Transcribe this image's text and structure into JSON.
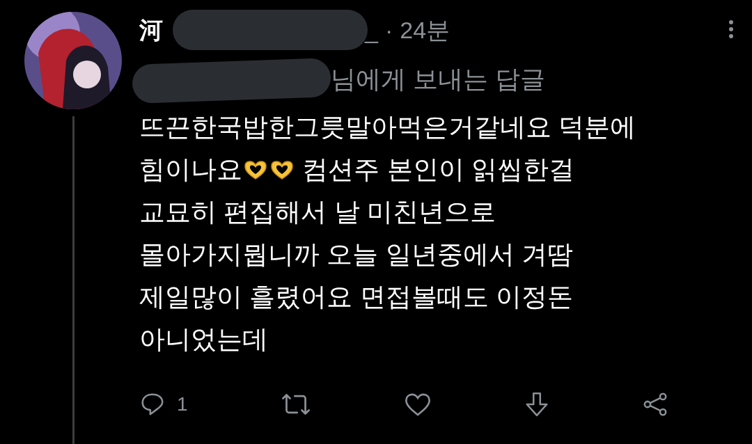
{
  "tweet": {
    "author_name": "河",
    "handle_tail": "_",
    "separator": "·",
    "time": "24분",
    "reply_to": "님에게 보내는 답글",
    "body_lines": [
      [
        {
          "kind": "text",
          "text": "뜨끈한국밥한그릇말아먹은거같네요 덕분에"
        }
      ],
      [
        {
          "kind": "text",
          "text": "힘이나요"
        },
        {
          "kind": "emoji"
        },
        {
          "kind": "emoji"
        },
        {
          "kind": "text",
          "text": " 컴션주 본인이 읽씹한걸"
        }
      ],
      [
        {
          "kind": "text",
          "text": "교묘히 편집해서 날 미친년으로"
        }
      ],
      [
        {
          "kind": "text",
          "text": "몰아가지뭡니까 오늘 일년중에서 겨땀"
        }
      ],
      [
        {
          "kind": "text",
          "text": "제일많이 흘렸어요 면접볼때도 이정돈"
        }
      ],
      [
        {
          "kind": "text",
          "text": "아니었는데"
        }
      ]
    ],
    "reply_count": "1"
  }
}
